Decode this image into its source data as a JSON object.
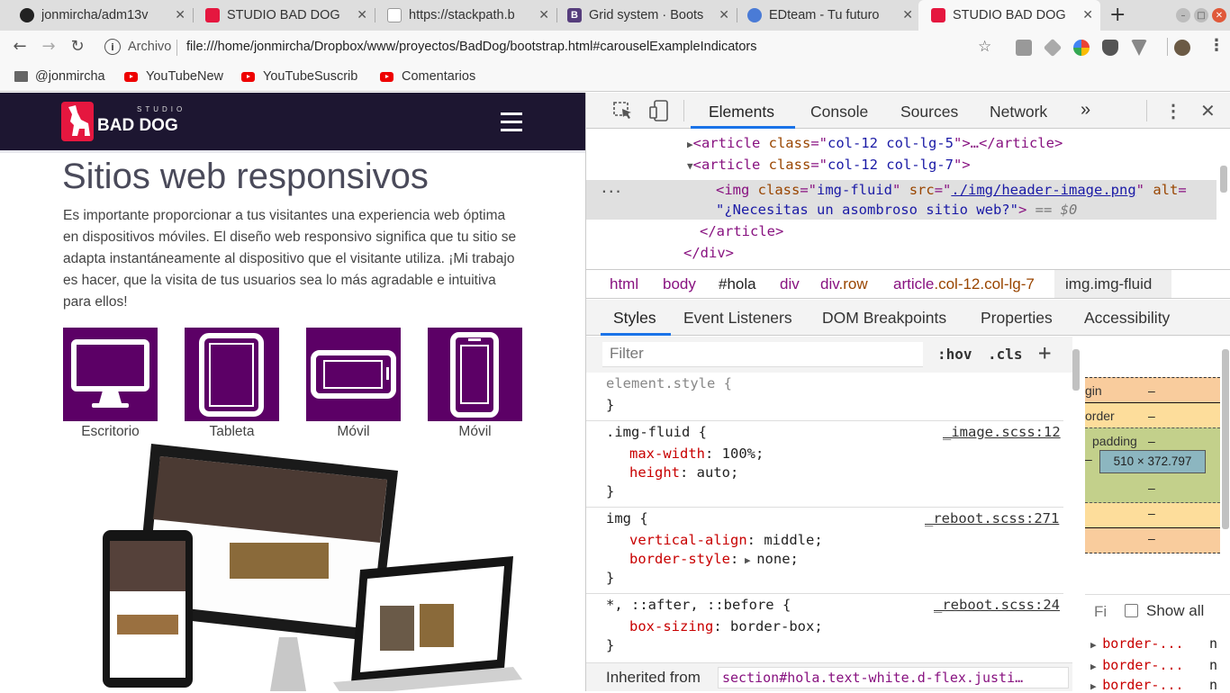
{
  "browser": {
    "tabs": [
      {
        "label": "jonmircha/adm13v",
        "icon": "github-icon",
        "color": "#222222"
      },
      {
        "label": "STUDIO BAD DOG",
        "icon": "baddog-favicon",
        "color": "#e5173f"
      },
      {
        "label": "https://stackpath.b",
        "icon": "page-icon",
        "color": "#999999"
      },
      {
        "label": "Grid system · Boots",
        "icon": "bootstrap-icon",
        "color": "#563d7c"
      },
      {
        "label": "EDteam - Tu futuro",
        "icon": "edteam-icon",
        "color": "#4a7bd6"
      },
      {
        "label": "STUDIO BAD DOG",
        "icon": "baddog-favicon",
        "color": "#e5173f"
      }
    ],
    "new_tab": "+",
    "url_scheme": "Archivo",
    "url": "file:///home/jonmircha/Dropbox/www/proyectos/BadDog/bootstrap.html#carouselExampleIndicators",
    "bookmarks": [
      {
        "label": "@jonmircha",
        "icon": "folder-icon"
      },
      {
        "label": "YouTubeNew",
        "icon": "youtube-icon"
      },
      {
        "label": "YouTubeSuscrib",
        "icon": "youtube-icon"
      },
      {
        "label": "Comentarios",
        "icon": "youtube-icon"
      }
    ]
  },
  "site": {
    "logo_small": "STUDIO",
    "logo_text": "BAD DOG",
    "title": "Sitios web responsivos",
    "intro": "Es importante proporcionar a tus visitantes una experiencia web óptima en dispositivos móviles. El diseño web responsivo significa que tu sitio se adapta instantáneamente al dispositivo que el visitante utiliza. ¡Mi trabajo es hacer, que la visita de tus usuarios sea lo más agradable e intuitiva para ellos!",
    "devices": [
      {
        "label": "Escritorio",
        "icon": "desktop-icon"
      },
      {
        "label": "Tableta",
        "icon": "tablet-icon"
      },
      {
        "label": "Móvil",
        "icon": "phone-landscape-icon"
      },
      {
        "label": "Móvil",
        "icon": "phone-portrait-icon"
      }
    ],
    "accent_color": "#5c0066",
    "nav_color": "#1d1631"
  },
  "devtools": {
    "tabs": [
      "Elements",
      "Console",
      "Sources",
      "Network"
    ],
    "more": "»",
    "dom": {
      "line1_tag": "article",
      "line1_attr": "class",
      "line1_val": "col-12 col-lg-5",
      "line1_rest": ">…</article>",
      "line2_tag": "article",
      "line2_attr": "class",
      "line2_val": "col-12 col-lg-7",
      "img_attr1": "class",
      "img_val1": "img-fluid",
      "img_attr2": "src",
      "img_val2": "./img/header-image.png",
      "img_attr3": "alt",
      "img_alt": "¿Necesitas un asombroso sitio web?",
      "img_eq": "== $0",
      "close_article": "</article>",
      "close_div": "</div>",
      "dots": "..."
    },
    "breadcrumbs": [
      {
        "tag": "html",
        "cls": ""
      },
      {
        "tag": "body",
        "cls": ""
      },
      {
        "tag": "#hola",
        "cls": ""
      },
      {
        "tag": "div",
        "cls": ""
      },
      {
        "tag": "div",
        "cls": ".row"
      },
      {
        "tag": "article",
        "cls": ".col-12.col-lg-7"
      },
      {
        "tag": "img",
        "cls": ".img-fluid"
      }
    ],
    "subtabs": [
      "Styles",
      "Event Listeners",
      "DOM Breakpoints",
      "Properties",
      "Accessibility"
    ],
    "filter_placeholder": "Filter",
    "hov": ":hov",
    "cls": ".cls",
    "plus": "+",
    "rules": [
      {
        "selector": "element.style {",
        "source": "",
        "decls": [],
        "close": "}"
      },
      {
        "selector": ".img-fluid {",
        "source": "_image.scss:12",
        "decls": [
          {
            "p": "max-width",
            "v": "100%;"
          },
          {
            "p": "height",
            "v": "auto;"
          }
        ],
        "close": "}"
      },
      {
        "selector": "img {",
        "source": "_reboot.scss:271",
        "decls": [
          {
            "p": "vertical-align",
            "v": "middle;"
          },
          {
            "p": "border-style",
            "v": "none;"
          }
        ],
        "close": "}"
      },
      {
        "selector": "*, ::after, ::before {",
        "source": "_reboot.scss:24",
        "decls": [
          {
            "p": "box-sizing",
            "v": "border-box;"
          }
        ],
        "close": "}"
      }
    ],
    "inherited_label": "Inherited from",
    "inherited_from": "section#hola.text-white.d-flex.justi…",
    "boxmodel": {
      "margin": "gin",
      "margin_val": "–",
      "border": "order",
      "border_val": "–",
      "padding": "padding",
      "padding_val": "–",
      "content": "510 × 372.797",
      "dash": "–"
    },
    "computed_filter": "Fi",
    "show_all": "Show all",
    "computed_items": [
      "border-...",
      "border-...",
      "border-..."
    ],
    "computed_vals": [
      "n",
      "n",
      "n"
    ]
  }
}
